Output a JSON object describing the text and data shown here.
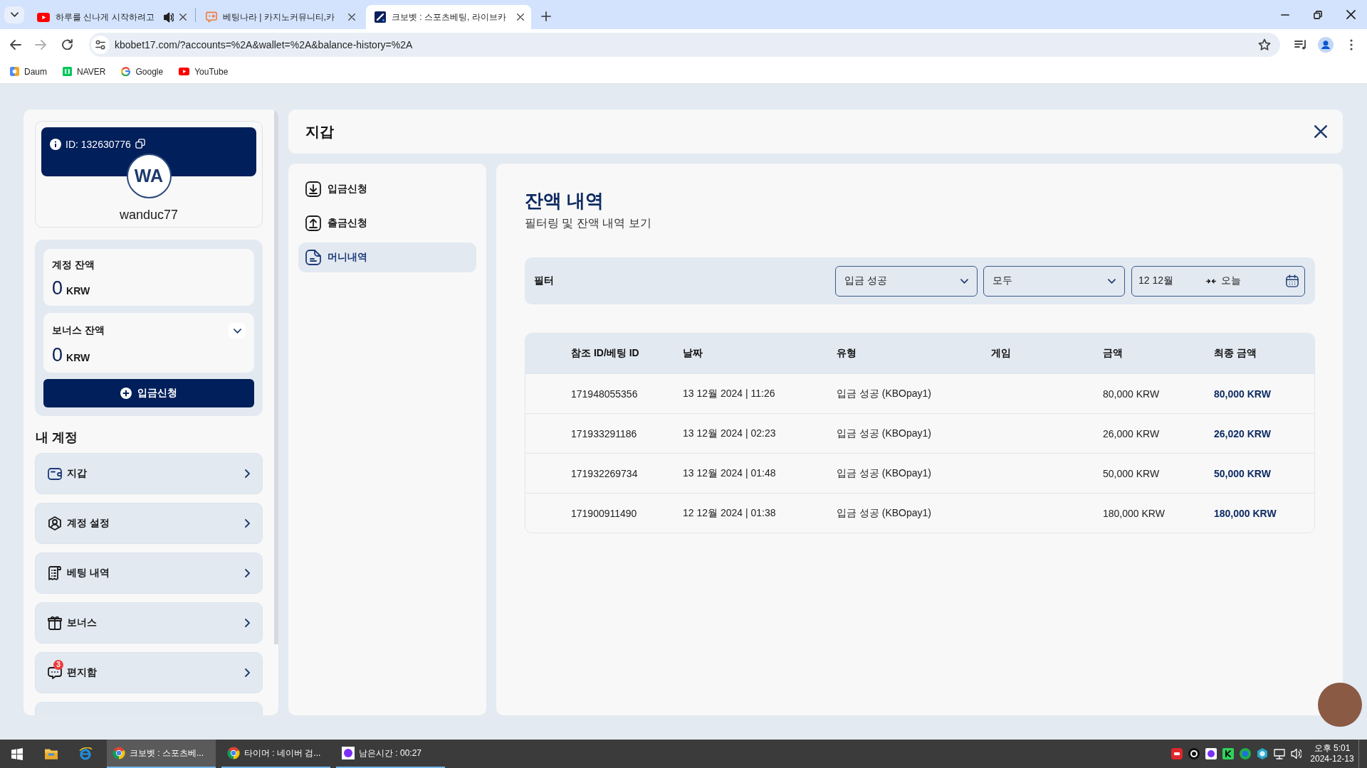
{
  "browser": {
    "tabs": [
      {
        "title": "하루를 신나게 시작하려고",
        "selected": false,
        "audio": true
      },
      {
        "title": "베팅나라 | 카지노커뮤니티,카",
        "selected": false,
        "audio": false
      },
      {
        "title": "크보벳 : 스포츠베팅, 라이브카",
        "selected": true,
        "audio": false
      }
    ],
    "url": "kbobet17.com/?accounts=%2A&wallet=%2A&balance-history=%2A",
    "bookmarks": [
      "Daum",
      "NAVER",
      "Google",
      "YouTube"
    ]
  },
  "sidebar": {
    "profile": {
      "id_label": "ID: 132630776",
      "initials": "WA",
      "username": "wanduc77"
    },
    "balances": [
      {
        "label": "계정 잔액",
        "amount": "0",
        "currency": "KRW",
        "expandable": false
      },
      {
        "label": "보너스 잔액",
        "amount": "0",
        "currency": "KRW",
        "expandable": true
      }
    ],
    "deposit_button": "입금신청",
    "section_title": "내 계정",
    "menu_items": [
      {
        "label": "지갑"
      },
      {
        "label": "계정 설정"
      },
      {
        "label": "베팅 내역"
      },
      {
        "label": "보너스"
      },
      {
        "label": "편지함",
        "badge": "3"
      }
    ],
    "more_below": true
  },
  "wallet": {
    "title": "지갑",
    "nav": [
      {
        "label": "입금신청",
        "selected": false
      },
      {
        "label": "출금신청",
        "selected": false
      },
      {
        "label": "머니내역",
        "selected": true
      }
    ],
    "content": {
      "title": "잔액 내역",
      "subtitle": "필터링 및 잔액 내역 보기",
      "filter": {
        "label": "필터",
        "status_select": "입금 성공",
        "game_select": "모두",
        "date_from": "12 12월",
        "date_to": "오늘"
      },
      "table": {
        "columns": [
          "참조 ID/베팅 ID",
          "날짜",
          "유형",
          "게임",
          "금액",
          "최종 금액"
        ],
        "rows": [
          {
            "ref_id": "171948055356",
            "date": "13 12월 2024 | 11:26",
            "type": "입금 성공 (KBOpay1)",
            "amount": "80,000 KRW",
            "final_amount": "80,000 KRW"
          },
          {
            "ref_id": "171933291186",
            "date": "13 12월 2024 | 02:23",
            "type": "입금 성공 (KBOpay1)",
            "amount": "26,000 KRW",
            "final_amount": "26,020 KRW"
          },
          {
            "ref_id": "171932269734",
            "date": "13 12월 2024 | 01:48",
            "type": "입금 성공 (KBOpay1)",
            "amount": "50,000 KRW",
            "final_amount": "50,000 KRW"
          },
          {
            "ref_id": "171900911490",
            "date": "12 12월 2024 | 01:38",
            "type": "입금 성공 (KBOpay1)",
            "amount": "180,000 KRW",
            "final_amount": "180,000 KRW"
          }
        ]
      }
    }
  },
  "taskbar": {
    "windows": [
      {
        "title": "크보벳 : 스포츠베...",
        "kind": "browser",
        "selected": true
      },
      {
        "title": "타이머 : 네이버 검...",
        "kind": "browser",
        "selected": false
      },
      {
        "title": "남은시간 : 00:27",
        "kind": "app",
        "selected": false
      }
    ],
    "clock": {
      "time": "오후 5:01",
      "date": "2024-12-13"
    }
  }
}
